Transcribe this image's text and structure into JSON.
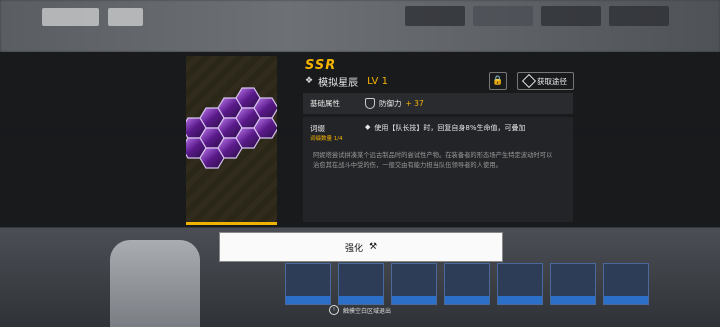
{
  "item": {
    "rarity": "SSR",
    "name": "模拟星辰",
    "level": "LV 1",
    "get_path_label": "获取途径"
  },
  "base_attribute": {
    "label": "基础属性",
    "stat_name": "防御力",
    "stat_bonus": "+ 37"
  },
  "skill": {
    "title": "词缀",
    "count": "词缀数量 1/4",
    "effect": "使用【队长技】时，回复自身8%生命值，可叠加",
    "description": "阿妮塔尝试拼凑某个远古制品时的尝试性产物。在装备者的形态场产生特定波动时可以治愈其在战斗中受的伤，一般交由有能力担当队伍领导者的人使用。"
  },
  "enhance_label": "强化",
  "exit_hint": "触摸空白区域退出",
  "colors": {
    "accent": "#f5b300",
    "crystal": "#9b3dd8"
  },
  "icons": [
    "back-icon",
    "home-icon",
    "lock-icon",
    "source-icon",
    "shield-icon",
    "hammer-icon",
    "info-icon"
  ]
}
